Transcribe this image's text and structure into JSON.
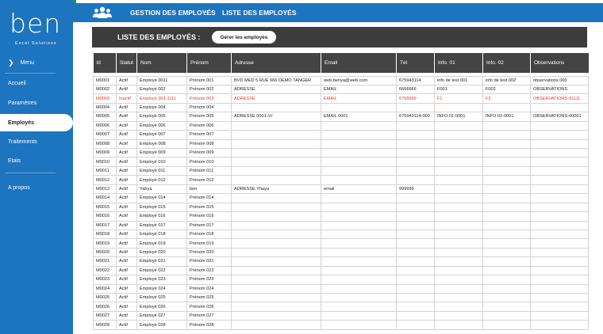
{
  "app": {
    "logo_text": "ben",
    "logo_subtitle": "Excel Solutions"
  },
  "sidebar": {
    "menu_label": "Menu",
    "items": [
      {
        "label": "Accueil"
      },
      {
        "label": "Paramètres"
      },
      {
        "label": "Employés"
      },
      {
        "label": "Traitements"
      },
      {
        "label": "Etats"
      },
      {
        "label": "A propos"
      }
    ]
  },
  "header": {
    "title": "GESTION DES EMPLOYÉS",
    "separator": ":",
    "subtitle": "LISTE DES EMPLOYÉS"
  },
  "banner": {
    "title": "LISTE DES EMPLOYÉS :",
    "manage_button": "Gérer les employés"
  },
  "table": {
    "columns": [
      "Id",
      "Statut",
      "Nom",
      "Prénom",
      "Adresse",
      "Email",
      "Tél",
      "Info. 01",
      "Info. 02",
      "Observations"
    ],
    "rows": [
      [
        "M0001",
        "Actif",
        "Employé 0011",
        "Prénom 001",
        "BVD MED 5 RUE 666 DEMO TANGER",
        "web.benya@web.com",
        "675943114",
        "info de test 001",
        "info de test 002",
        "observations 000"
      ],
      [
        "M0002",
        "Actif",
        "Employé 002",
        "Prénom 002",
        "ADRESSE",
        "EMAIL",
        "6666666",
        "F001",
        "F002",
        "OBSERVATIONS"
      ],
      [
        "M0003",
        "Inactif",
        "Employé 003-1111",
        "Prénom 003",
        "ADRESSE",
        "EMAIL",
        "6759999",
        "F1",
        "F2",
        "OBSERVATIONS-01111"
      ],
      [
        "M0004",
        "Actif",
        "Employé 004",
        "Prénom 004",
        "",
        "",
        "",
        "",
        "",
        ""
      ],
      [
        "M0005",
        "Actif",
        "Employé 005",
        "Prénom 005",
        "ADRESSE 0001 ////",
        "EMAIL 0001",
        "675943114-000",
        "INFO 01-0001",
        "INFO 02-0001",
        "OBSERVATIONS-00001"
      ],
      [
        "M0006",
        "Actif",
        "Employé 006",
        "Prénom 006",
        "",
        "",
        "",
        "",
        "",
        ""
      ],
      [
        "M0007",
        "Actif",
        "Employé 007",
        "Prénom 007",
        "",
        "",
        "",
        "",
        "",
        ""
      ],
      [
        "M0008",
        "Actif",
        "Employé 008",
        "Prénom 008",
        "",
        "",
        "",
        "",
        "",
        ""
      ],
      [
        "M0009",
        "Actif",
        "Employé 009",
        "Prénom 009",
        "",
        "",
        "",
        "",
        "",
        ""
      ],
      [
        "M0010",
        "Actif",
        "Employé 010",
        "Prénom 010",
        "",
        "",
        "",
        "",
        "",
        ""
      ],
      [
        "M0011",
        "Actif",
        "Employé 011",
        "Prénom 011",
        "",
        "",
        "",
        "",
        "",
        ""
      ],
      [
        "M0012",
        "Actif",
        "Employé 012",
        "Prénom 012",
        "",
        "",
        "",
        "",
        "",
        ""
      ],
      [
        "M0013",
        "Actif",
        "Yahya",
        "ben",
        "ADRESSE Yhaya",
        "email",
        "999999",
        "",
        "",
        ""
      ],
      [
        "M0014",
        "Actif",
        "Employé 014",
        "Prénom 014",
        "",
        "",
        "",
        "",
        "",
        ""
      ],
      [
        "M0015",
        "Actif",
        "Employé 015",
        "Prénom 015",
        "",
        "",
        "",
        "",
        "",
        ""
      ],
      [
        "M0016",
        "Actif",
        "Employé 016",
        "Prénom 016",
        "",
        "",
        "",
        "",
        "",
        ""
      ],
      [
        "M0017",
        "Actif",
        "Employé 017",
        "Prénom 017",
        "",
        "",
        "",
        "",
        "",
        ""
      ],
      [
        "M0018",
        "Actif",
        "Employé 018",
        "Prénom 018",
        "",
        "",
        "",
        "",
        "",
        ""
      ],
      [
        "M0019",
        "Actif",
        "Employé 019",
        "Prénom 019",
        "",
        "",
        "",
        "",
        "",
        ""
      ],
      [
        "M0020",
        "Actif",
        "Employé 020",
        "Prénom 020",
        "",
        "",
        "",
        "",
        "",
        ""
      ],
      [
        "M0021",
        "Actif",
        "Employé 021",
        "Prénom 021",
        "",
        "",
        "",
        "",
        "",
        ""
      ],
      [
        "M0022",
        "Actif",
        "Employé 022",
        "Prénom 022",
        "",
        "",
        "",
        "",
        "",
        ""
      ],
      [
        "M0023",
        "Actif",
        "Employé 023",
        "Prénom 023",
        "",
        "",
        "",
        "",
        "",
        ""
      ],
      [
        "M0024",
        "Actif",
        "Employé 024",
        "Prénom 024",
        "",
        "",
        "",
        "",
        "",
        ""
      ],
      [
        "M0025",
        "Actif",
        "Employé 025",
        "Prénom 025",
        "",
        "",
        "",
        "",
        "",
        ""
      ],
      [
        "M0026",
        "Actif",
        "Employé 026",
        "Prénom 026",
        "",
        "",
        "",
        "",
        "",
        ""
      ],
      [
        "M0027",
        "Actif",
        "Employé 027",
        "Prénom 027",
        "",
        "",
        "",
        "",
        "",
        ""
      ],
      [
        "M0028",
        "Actif",
        "Employé 028",
        "Prénom 028",
        "",
        "",
        "",
        "",
        "",
        ""
      ]
    ]
  },
  "colors": {
    "primary_blue": "#1d74bf",
    "banner_dark": "#3c3c3c",
    "header_dark": "#444444",
    "inactive_red": "#e23b2c"
  },
  "icons": {
    "header": "users-icon",
    "menu": "chevron-right-icon"
  }
}
